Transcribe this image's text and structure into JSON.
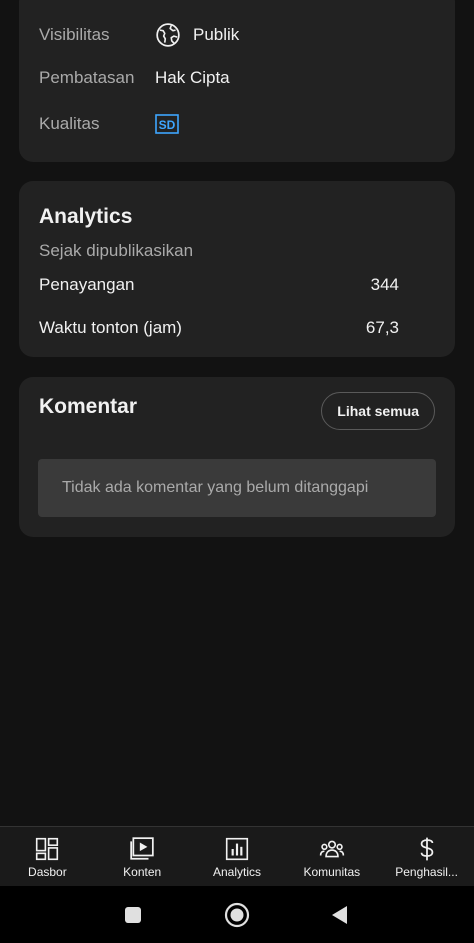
{
  "details": {
    "visibility_label": "Visibilitas",
    "visibility_value": "Publik",
    "restriction_label": "Pembatasan",
    "restriction_value": "Hak Cipta",
    "quality_label": "Kualitas",
    "quality_badge": "SD"
  },
  "analytics": {
    "title": "Analytics",
    "subtitle": "Sejak dipublikasikan",
    "metrics": [
      {
        "label": "Penayangan",
        "value": "344"
      },
      {
        "label": "Waktu tonton (jam)",
        "value": "67,3"
      }
    ]
  },
  "comments": {
    "title": "Komentar",
    "see_all_label": "Lihat semua",
    "empty_text": "Tidak ada komentar yang belum ditanggapi"
  },
  "bottom_nav": [
    {
      "label": "Dasbor",
      "icon": "dashboard-icon"
    },
    {
      "label": "Konten",
      "icon": "content-icon"
    },
    {
      "label": "Analytics",
      "icon": "analytics-icon"
    },
    {
      "label": "Komunitas",
      "icon": "community-icon"
    },
    {
      "label": "Penghasil...",
      "icon": "earn-icon"
    }
  ],
  "colors": {
    "background": "#121212",
    "card": "#222222",
    "sd_badge": "#3ea6ff"
  }
}
